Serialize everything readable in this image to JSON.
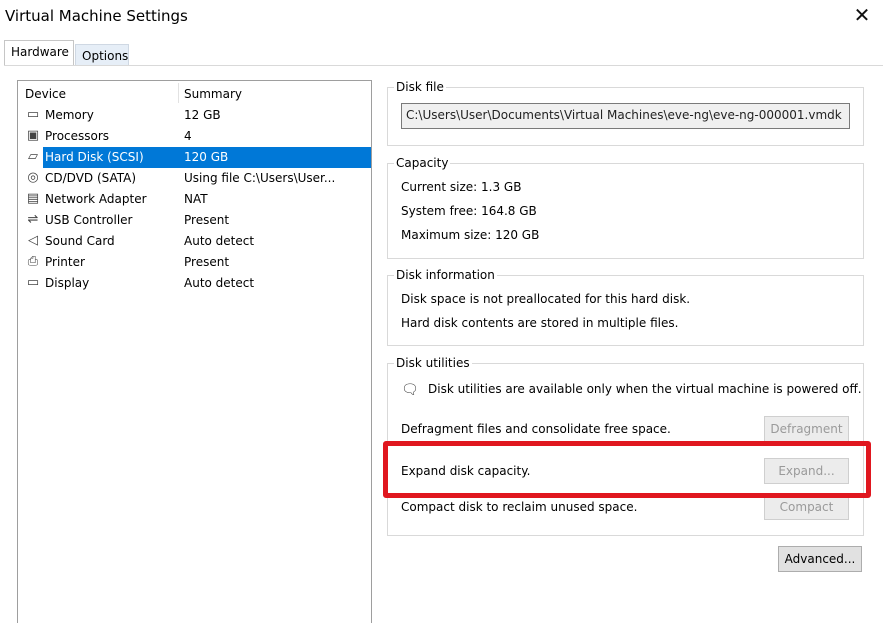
{
  "window": {
    "title": "Virtual Machine Settings"
  },
  "tabs": [
    {
      "label": "Hardware",
      "active": true
    },
    {
      "label": "Options",
      "active": false
    }
  ],
  "device_list": {
    "columns": [
      "Device",
      "Summary"
    ],
    "items": [
      {
        "icon": "memory-icon",
        "name": "Memory",
        "summary": "12 GB"
      },
      {
        "icon": "processor-icon",
        "name": "Processors",
        "summary": "4"
      },
      {
        "icon": "hard-disk-icon",
        "name": "Hard Disk (SCSI)",
        "summary": "120 GB",
        "selected": true
      },
      {
        "icon": "cd-dvd-icon",
        "name": "CD/DVD (SATA)",
        "summary": "Using file C:\\Users\\User..."
      },
      {
        "icon": "network-adapter-icon",
        "name": "Network Adapter",
        "summary": "NAT"
      },
      {
        "icon": "usb-icon",
        "name": "USB Controller",
        "summary": "Present"
      },
      {
        "icon": "sound-card-icon",
        "name": "Sound Card",
        "summary": "Auto detect"
      },
      {
        "icon": "printer-icon",
        "name": "Printer",
        "summary": "Present"
      },
      {
        "icon": "display-icon",
        "name": "Display",
        "summary": "Auto detect"
      }
    ]
  },
  "disk_file": {
    "legend": "Disk file",
    "path": "C:\\Users\\User\\Documents\\Virtual Machines\\eve-ng\\eve-ng-000001.vmdk"
  },
  "capacity": {
    "legend": "Capacity",
    "current_size": "Current size: 1.3 GB",
    "system_free": "System free: 164.8 GB",
    "maximum_size": "Maximum size: 120 GB"
  },
  "disk_information": {
    "legend": "Disk information",
    "line1": "Disk space is not preallocated for this hard disk.",
    "line2": "Hard disk contents are stored in multiple files."
  },
  "disk_utilities": {
    "legend": "Disk utilities",
    "notice": "Disk utilities are available only when the virtual machine is powered off.",
    "defragment_text": "Defragment files and consolidate free space.",
    "defragment_button": "Defragment",
    "expand_text": "Expand disk capacity.",
    "expand_button": "Expand...",
    "compact_text": "Compact disk to reclaim unused space.",
    "compact_button": "Compact"
  },
  "advanced_button": "Advanced...",
  "colors": {
    "selection": "#0078d7",
    "highlight": "#e0171f"
  }
}
